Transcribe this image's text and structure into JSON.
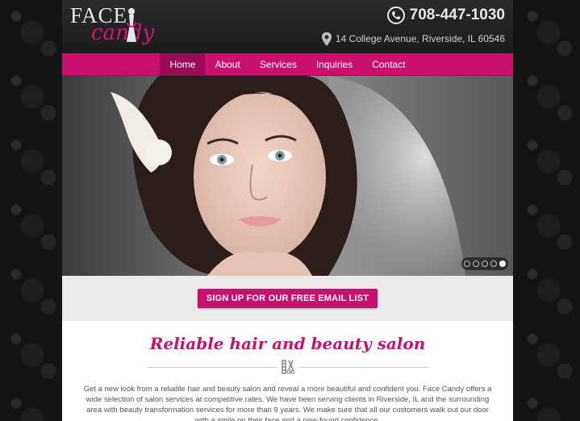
{
  "brand": {
    "logo_top": "FACE",
    "logo_bottom": "candy",
    "accent_color": "#c8106e"
  },
  "header": {
    "phone": "708-447-1030",
    "address": "14 College Avenue, Riverside, IL 60546",
    "phone_icon": "phone-icon",
    "address_icon": "map-pin-icon"
  },
  "nav": {
    "items": [
      {
        "label": "Home",
        "active": true
      },
      {
        "label": "About"
      },
      {
        "label": "Services"
      },
      {
        "label": "Inquiries"
      },
      {
        "label": "Contact"
      }
    ]
  },
  "slider": {
    "slide_count": 5,
    "active_index": 4
  },
  "signup": {
    "button_label": "SIGN UP FOR OUR FREE EMAIL LIST"
  },
  "intro": {
    "heading": "Reliable hair and beauty salon",
    "divider_icon": "comb-scissors-icon",
    "paragraph": "Get a new look from a reliable hair and beauty salon and reveal a more beautiful and confident you. Face Candy offers a wide selection of salon services at competitive rates. We have been serving clients in Riverside, IL and the surrounding area with beauty transformation services for more than 9 years. We make sure that all our customers walk out our door with a smile on their face and a new-found confidence."
  }
}
